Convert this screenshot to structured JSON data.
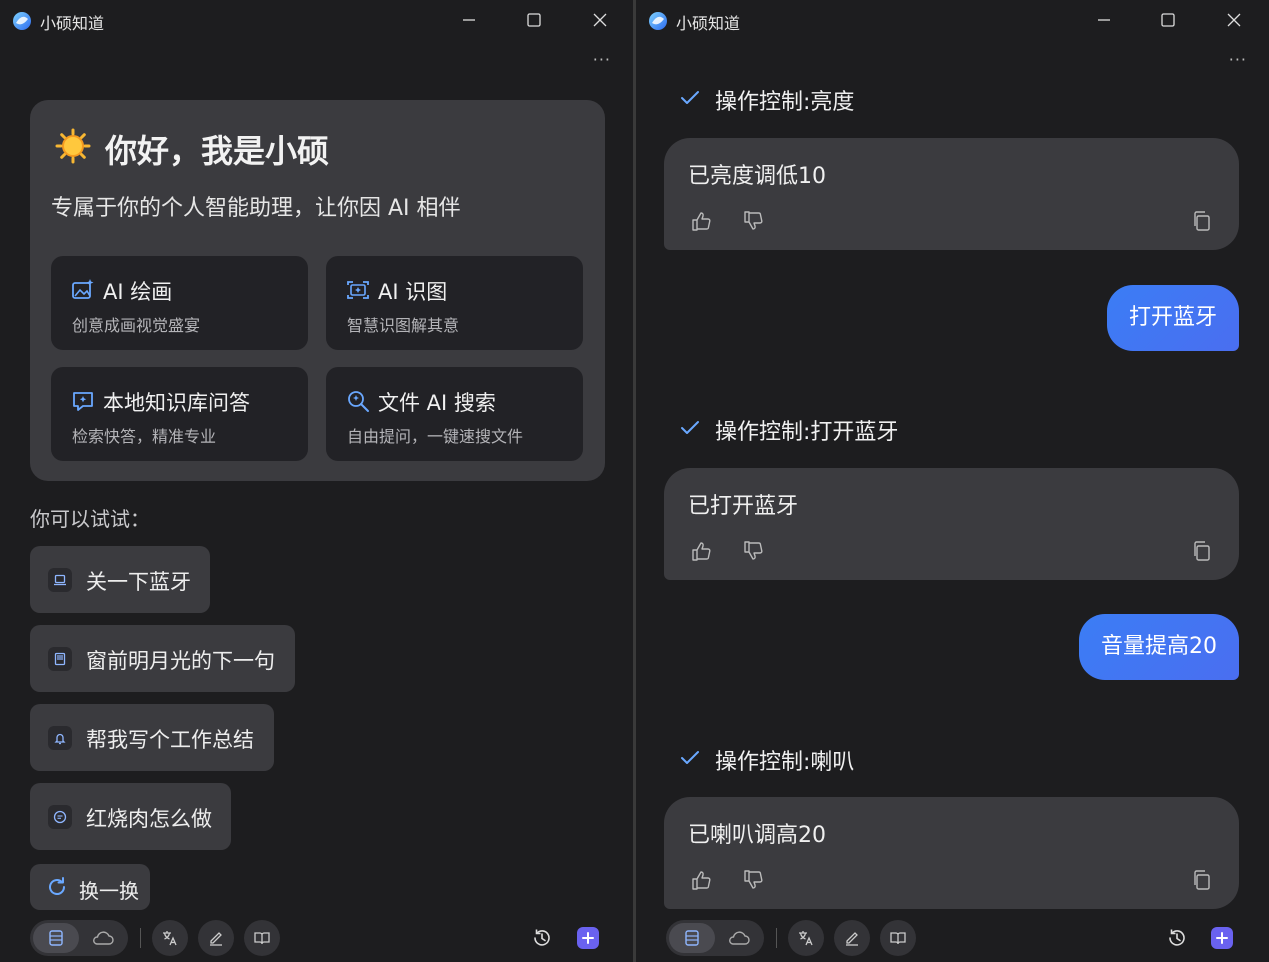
{
  "app": {
    "title": "小硕知道",
    "more": "···"
  },
  "left": {
    "welcome": {
      "greeting": "你好，我是小硕",
      "subtitle": "专属于你的个人智能助理，让你因 AI 相伴",
      "features": [
        {
          "title": "AI 绘画",
          "desc": "创意成画视觉盛宴",
          "icon": "image-sparkle-icon"
        },
        {
          "title": "AI 识图",
          "desc": "智慧识图解其意",
          "icon": "image-scan-icon"
        },
        {
          "title": "本地知识库问答",
          "desc": "检索快答，精准专业",
          "icon": "chat-knowledge-icon"
        },
        {
          "title": "文件 AI 搜索",
          "desc": "自由提问，一键速搜文件",
          "icon": "file-search-icon"
        }
      ]
    },
    "try_label": "你可以试试：",
    "suggestions": [
      {
        "text": "关一下蓝牙",
        "icon": "laptop-icon"
      },
      {
        "text": "窗前明月光的下一句",
        "icon": "book-icon"
      },
      {
        "text": "帮我写个工作总结",
        "icon": "bell-icon"
      },
      {
        "text": "红烧肉怎么做",
        "icon": "chat-icon"
      }
    ],
    "refresh": "换一换"
  },
  "right": {
    "messages": [
      {
        "type": "op",
        "text": "操作控制:亮度"
      },
      {
        "type": "reply",
        "text": "已亮度调低10"
      },
      {
        "type": "user",
        "text": "打开蓝牙"
      },
      {
        "type": "op",
        "text": "操作控制:打开蓝牙"
      },
      {
        "type": "reply",
        "text": "已打开蓝牙"
      },
      {
        "type": "user",
        "text": "音量提高20"
      },
      {
        "type": "op",
        "text": "操作控制:喇叭"
      },
      {
        "type": "reply",
        "text": "已喇叭调高20"
      }
    ]
  },
  "colors": {
    "background": "#1d1d1f",
    "card": "#3b3b3f",
    "accent_blue": "#3b7df5",
    "new_chat": "#6a62f0"
  }
}
